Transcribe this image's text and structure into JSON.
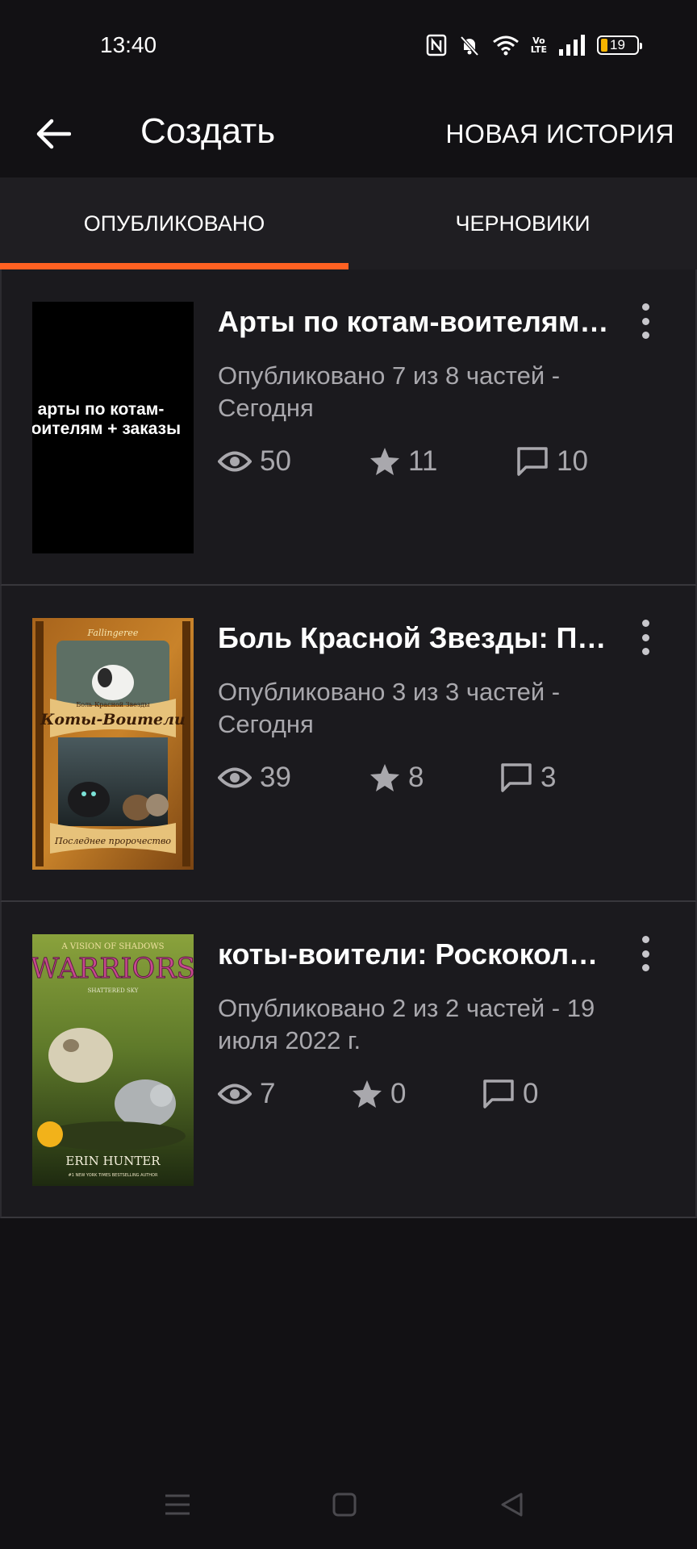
{
  "status": {
    "time": "13:40",
    "volte_line1": "Vo",
    "volte_line2": "LTE",
    "battery": "19"
  },
  "header": {
    "title": "Создать",
    "new_story": "НОВАЯ ИСТОРИЯ"
  },
  "tabs": [
    {
      "label": "ОПУБЛИКОВАНО",
      "active": true
    },
    {
      "label": "ЧЕРНОВИКИ",
      "active": false
    }
  ],
  "stories": [
    {
      "title": "Арты по котам-воителям…",
      "meta": "Опубликовано 7 из 8 частей - Сегодня",
      "views": "50",
      "votes": "11",
      "comments": "10",
      "cover_text": "арты по котам-воителям + заказы"
    },
    {
      "title": " Боль Красной Звезды: П…",
      "meta": "Опубликовано 3 из 3 частей - Сегодня",
      "views": "39",
      "votes": "8",
      "comments": "3",
      "cover_top": "Fallingeree",
      "cover_sub": "Боль Красной Звезды",
      "cover_title": "Коты-Воители",
      "cover_bottom": "Последнее пророчество"
    },
    {
      "title": "коты-воители: Роскокол…",
      "meta": "Опубликовано 2 из 2 частей - 19 июля 2022 г.",
      "views": "7",
      "votes": "0",
      "comments": "0",
      "cover_series": "A VISION OF SHADOWS",
      "cover_title": "WARRIORS",
      "cover_sub": "SHATTERED SKY",
      "cover_author": "ERIN HUNTER",
      "cover_tagline": "#1 NEW YORK TIMES BESTSELLING AUTHOR"
    }
  ],
  "icons": {
    "back": "arrow-left-icon",
    "views": "eye-icon",
    "votes": "star-icon",
    "comments": "comment-icon",
    "more": "more-vertical-icon"
  },
  "colors": {
    "accent": "#ff6122",
    "background": "#121114",
    "card": "#1b1a1e",
    "muted_text": "#a9a8ad"
  }
}
